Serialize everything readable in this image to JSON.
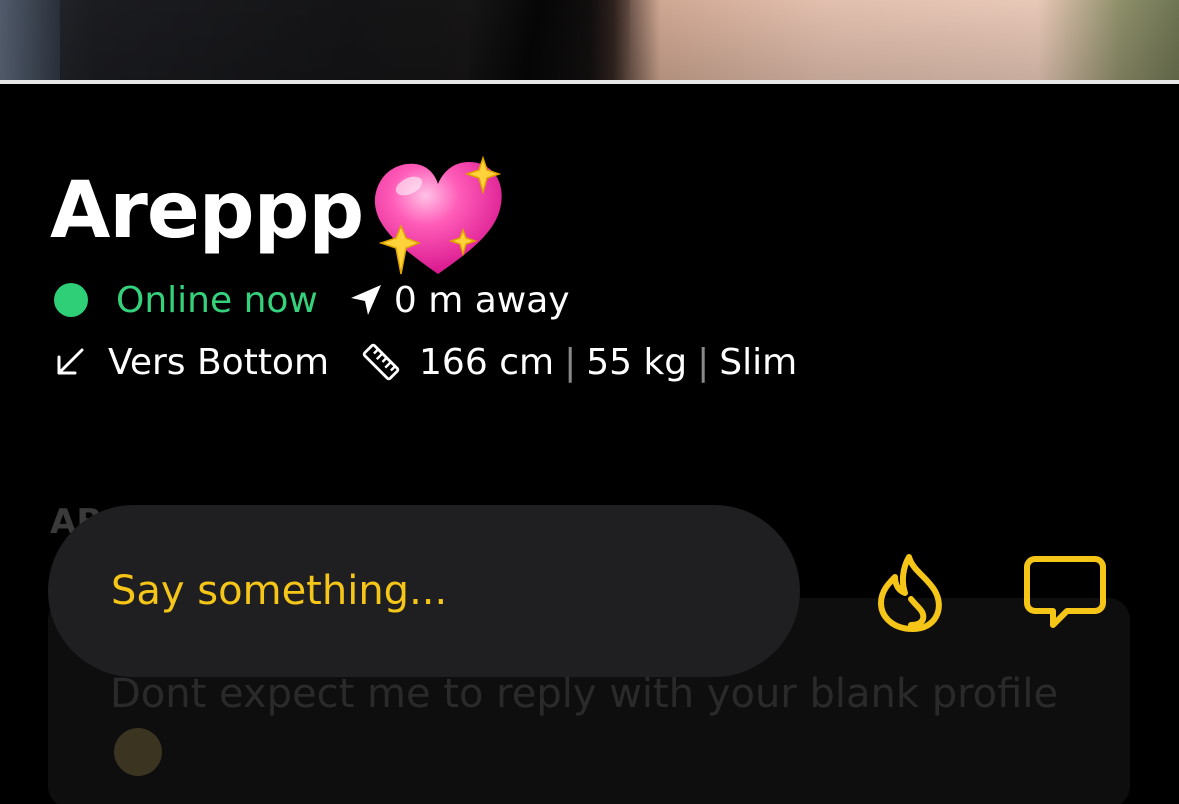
{
  "profile": {
    "name": "Areppp",
    "name_emoji": "sparkling-heart-emoji",
    "status": "Online now",
    "distance": "0 m away",
    "position": "Vers Bottom",
    "height": "166 cm",
    "weight": "55 kg",
    "body_type": "Slim",
    "separator": "|"
  },
  "about": {
    "label": "AB",
    "text": "Dont expect me to reply with your blank profile"
  },
  "compose": {
    "placeholder": "Say something..."
  },
  "icons": {
    "status_dot": "online-dot-icon",
    "location": "location-arrow-icon",
    "position": "arrow-down-left-icon",
    "measure": "ruler-icon",
    "tap": "flame-icon",
    "chat": "chat-bubble-icon"
  },
  "colors": {
    "background": "#000000",
    "online_green": "#35d27c",
    "accent_yellow": "#f5c518",
    "input_bg": "#1f1f21",
    "heart_pink": "#ff3fa4",
    "sparkle_yellow": "#ffd23c"
  }
}
